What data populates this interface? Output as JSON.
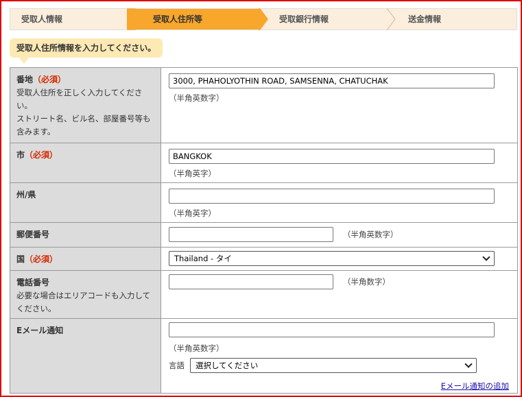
{
  "steps": [
    {
      "label": "受取人情報",
      "active": false
    },
    {
      "label": "受取人住所等",
      "active": true
    },
    {
      "label": "受取銀行情報",
      "active": false
    },
    {
      "label": "送金情報",
      "active": false
    }
  ],
  "instruction": "受取人住所情報を入力してください。",
  "fields": {
    "address": {
      "label": "番地",
      "required": "（必須）",
      "note1": "受取人住所を正しく入力してください。",
      "note2": "ストリート名、ビル名、部屋番号等も含みます。",
      "value": "3000, PHAHOLYOTHIN ROAD, SAMSENNA, CHATUCHAK",
      "hint": "（半角英数字）"
    },
    "city": {
      "label": "市",
      "required": "（必須）",
      "value": "BANGKOK",
      "hint": "（半角英字）"
    },
    "state": {
      "label": "州/県",
      "value": "",
      "hint": "（半角英字）"
    },
    "postal": {
      "label": "郵便番号",
      "value": "",
      "hint": "（半角英数字）"
    },
    "country": {
      "label": "国",
      "required": "（必須）",
      "selected": "Thailand - タイ"
    },
    "phone": {
      "label": "電話番号",
      "note": "必要な場合はエリアコードも入力してください。",
      "value": "",
      "hint": "（半角数字）"
    },
    "email": {
      "label": "Eメール通知",
      "value": "",
      "hint": "（半角英数字）",
      "lang_label": "言語",
      "lang_selected": "選択してください",
      "add_link": "Eメール通知の追加"
    }
  },
  "colors": {
    "step_active": "#f8a62c",
    "required": "#d42a00",
    "frame": "#e00000"
  }
}
